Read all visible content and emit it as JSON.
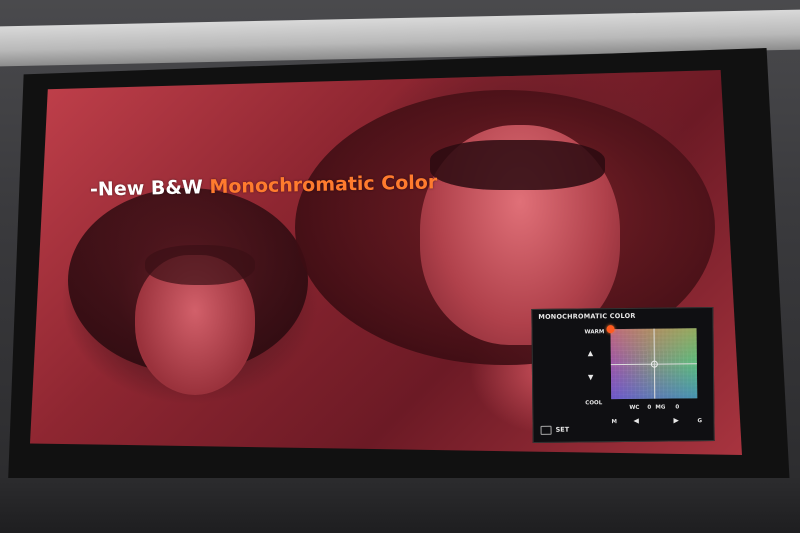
{
  "slide": {
    "headline_prefix": "-New B&W ",
    "headline_accent": "Monochromatic Color",
    "accent_color": "#ff7b2e"
  },
  "panel": {
    "title": "MONOCHROMATIC COLOR",
    "warm": "WARM",
    "cool": "COOL",
    "up_icon": "▲",
    "down_icon": "▼",
    "left_icon": "◀",
    "right_icon": "▶",
    "wc": "WC",
    "wc_value": "0",
    "mg": "MG",
    "mg_value": "0",
    "m": "M",
    "g": "G",
    "set_label": "SET",
    "set_icon": "MENU",
    "marker_color": "#ff5a1f"
  }
}
